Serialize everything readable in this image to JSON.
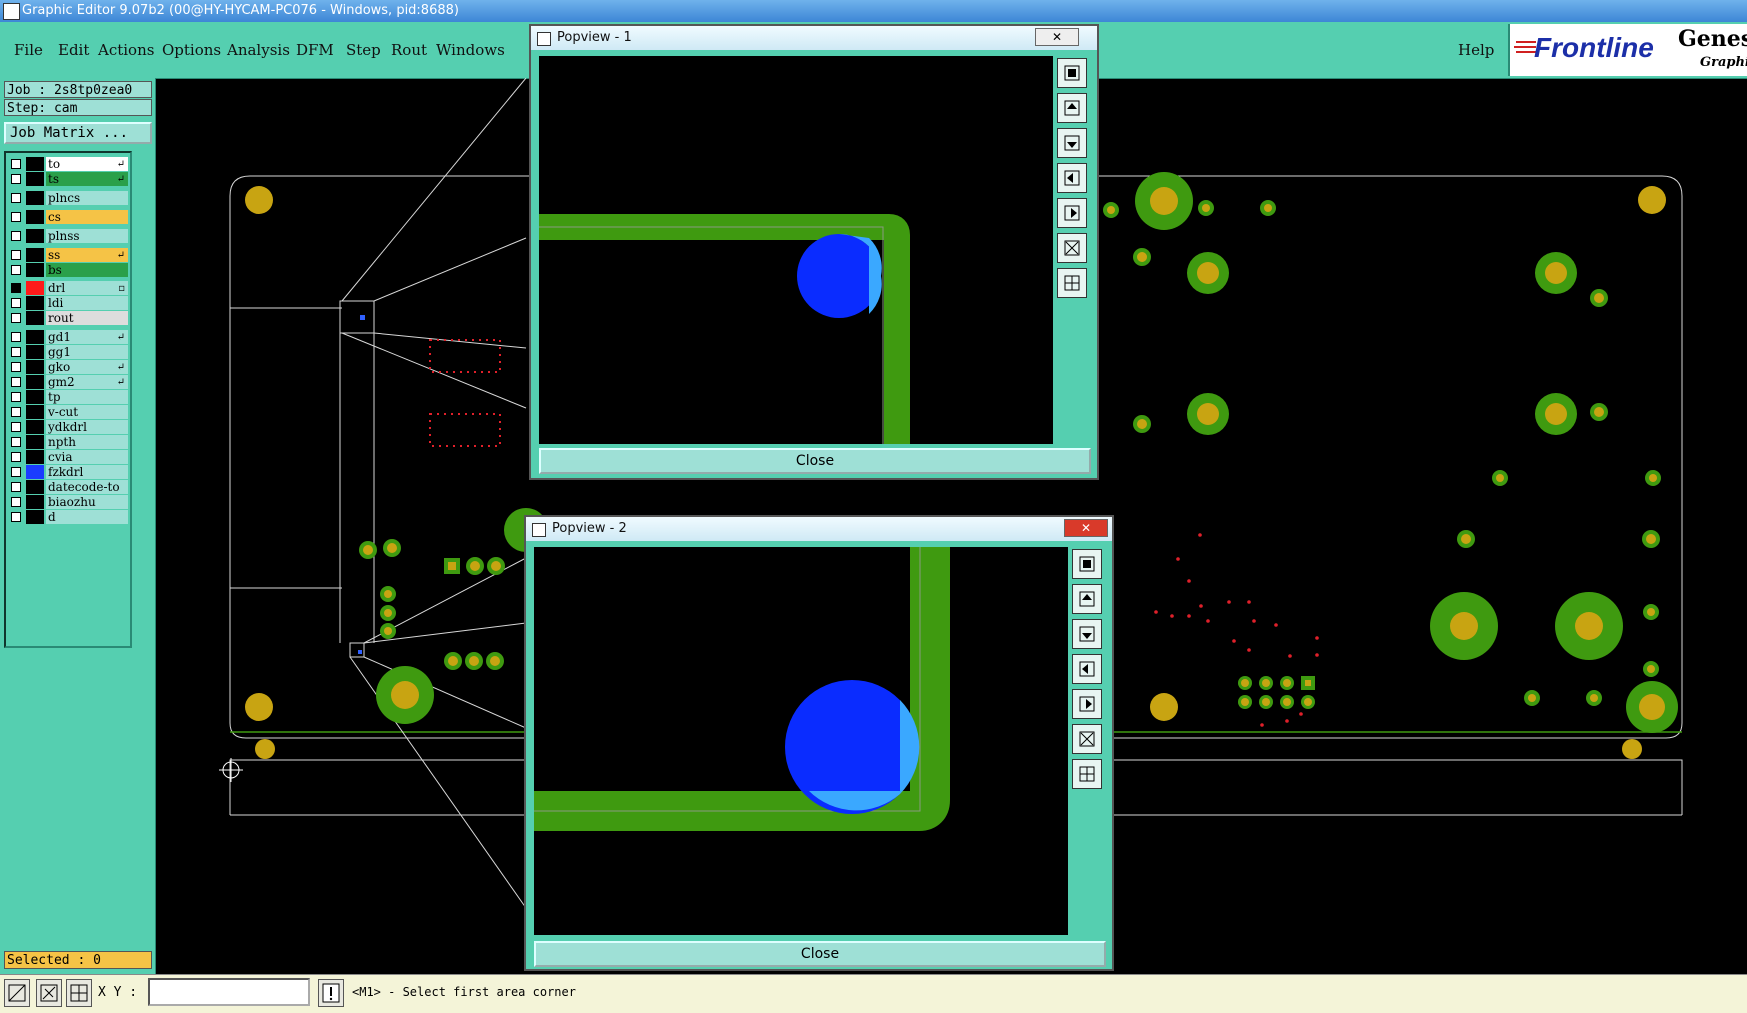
{
  "window": {
    "title": "Graphic Editor 9.07b2 (00@HY-HYCAM-PC076 - Windows, pid:8688)"
  },
  "menu": {
    "items": [
      "File",
      "Edit",
      "Actions",
      "Options",
      "Analysis",
      "DFM",
      "Step",
      "Rout",
      "Windows"
    ],
    "help": "Help"
  },
  "brand": {
    "logo": "Frontline",
    "product": "Genesi",
    "subtitle": "Graphic"
  },
  "job": {
    "job_line": "Job : 2s8tp0zea0",
    "step_line": "Step: cam",
    "matrix_button": "Job Matrix ..."
  },
  "layers": [
    {
      "name": "to",
      "color": "#ffffff",
      "mark": "↵",
      "on": false
    },
    {
      "name": "ts",
      "color": "#2aa04a",
      "mark": "↵",
      "on": false
    },
    {
      "name": "plncs",
      "color": "#9ee0d6",
      "mark": "",
      "on": false
    },
    {
      "name": "cs",
      "color": "#f5c346",
      "mark": "",
      "on": false
    },
    {
      "name": "plnss",
      "color": "#9ee0d6",
      "mark": "",
      "on": false
    },
    {
      "name": "ss",
      "color": "#f5c346",
      "mark": "↵",
      "on": false
    },
    {
      "name": "bs",
      "color": "#2aa04a",
      "mark": "",
      "on": false
    },
    {
      "name": "drl",
      "color": "#9ee0d6",
      "mark": "▫",
      "on": true,
      "swatch": "#ff1a1a"
    },
    {
      "name": "ldi",
      "color": "#9ee0d6",
      "mark": "",
      "on": false
    },
    {
      "name": "rout",
      "color": "#dddddd",
      "mark": "",
      "on": false
    },
    {
      "name": "gd1",
      "color": "#9ee0d6",
      "mark": "↵",
      "on": false
    },
    {
      "name": "gg1",
      "color": "#9ee0d6",
      "mark": "",
      "on": false
    },
    {
      "name": "gko",
      "color": "#9ee0d6",
      "mark": "↵",
      "on": false
    },
    {
      "name": "gm2",
      "color": "#9ee0d6",
      "mark": "↵",
      "on": false
    },
    {
      "name": "tp",
      "color": "#9ee0d6",
      "mark": "",
      "on": false
    },
    {
      "name": "v-cut",
      "color": "#9ee0d6",
      "mark": "",
      "on": false
    },
    {
      "name": "ydkdrl",
      "color": "#9ee0d6",
      "mark": "",
      "on": false
    },
    {
      "name": "npth",
      "color": "#9ee0d6",
      "mark": "",
      "on": false
    },
    {
      "name": "cvia",
      "color": "#9ee0d6",
      "mark": "",
      "on": false
    },
    {
      "name": "fzkdrl",
      "color": "#9ee0d6",
      "mark": "",
      "on": false,
      "swatch": "#1a3cff"
    },
    {
      "name": "datecode-to",
      "color": "#9ee0d6",
      "mark": "",
      "on": false
    },
    {
      "name": "biaozhu",
      "color": "#9ee0d6",
      "mark": "",
      "on": false
    },
    {
      "name": "d",
      "color": "#9ee0d6",
      "mark": "",
      "on": false
    }
  ],
  "status": {
    "selected": "Selected : 0",
    "xy_label": "X Y :",
    "xy_value": "",
    "prompt": "<M1> - Select first area corner"
  },
  "popview1": {
    "title": "Popview - 1",
    "close": "Close"
  },
  "popview2": {
    "title": "Popview - 2",
    "close": "Close"
  },
  "colors": {
    "panel": "#55cfb0",
    "copper": "#3f9a10",
    "pad": "#c8a412",
    "drill": "#0a2cff",
    "drill_light": "#3aa8ff",
    "outline": "#d8d8d8"
  }
}
